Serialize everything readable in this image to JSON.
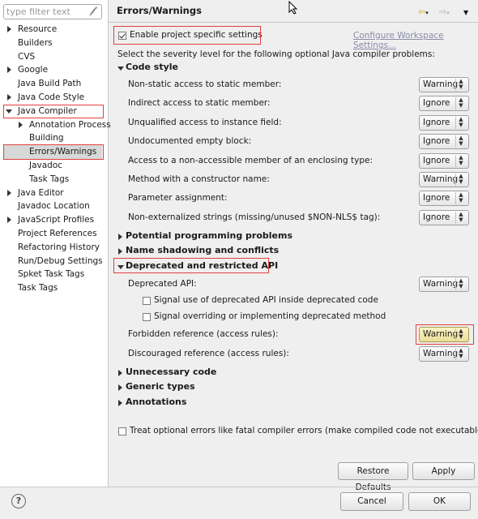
{
  "filter": {
    "placeholder": "type filter text"
  },
  "tree": [
    {
      "label": "Resource",
      "expandable": true
    },
    {
      "label": "Builders",
      "expandable": false
    },
    {
      "label": "CVS",
      "expandable": false
    },
    {
      "label": "Google",
      "expandable": true
    },
    {
      "label": "Java Build Path",
      "expandable": false
    },
    {
      "label": "Java Code Style",
      "expandable": true
    },
    {
      "label": "Java Compiler",
      "expandable": true,
      "expanded": true
    },
    {
      "label": "Annotation Process",
      "expandable": true,
      "child": true
    },
    {
      "label": "Building",
      "expandable": false,
      "child": true
    },
    {
      "label": "Errors/Warnings",
      "expandable": false,
      "child": true,
      "selected": true
    },
    {
      "label": "Javadoc",
      "expandable": false,
      "child": true
    },
    {
      "label": "Task Tags",
      "expandable": false,
      "child": true
    },
    {
      "label": "Java Editor",
      "expandable": true
    },
    {
      "label": "Javadoc Location",
      "expandable": false
    },
    {
      "label": "JavaScript Profiles",
      "expandable": true
    },
    {
      "label": "Project References",
      "expandable": false
    },
    {
      "label": "Refactoring History",
      "expandable": false
    },
    {
      "label": "Run/Debug Settings",
      "expandable": false
    },
    {
      "label": "Spket Task Tags",
      "expandable": false
    },
    {
      "label": "Task Tags",
      "expandable": false
    }
  ],
  "page": {
    "title": "Errors/Warnings",
    "enable_label": "Enable project specific settings",
    "configure_link": "Configure Workspace Settings...",
    "intro": "Select the severity level for the following optional Java compiler problems:"
  },
  "code_style": {
    "header": "Code style",
    "rows": [
      {
        "label": "Non-static access to static member:",
        "value": "Warning"
      },
      {
        "label": "Indirect access to static member:",
        "value": "Ignore"
      },
      {
        "label": "Unqualified access to instance field:",
        "value": "Ignore"
      },
      {
        "label": "Undocumented empty block:",
        "value": "Ignore"
      },
      {
        "label": "Access to a non-accessible member of an enclosing type:",
        "value": "Ignore"
      },
      {
        "label": "Method with a constructor name:",
        "value": "Warning"
      },
      {
        "label": "Parameter assignment:",
        "value": "Ignore"
      },
      {
        "label": "Non-externalized strings (missing/unused $NON-NLS$ tag):",
        "value": "Ignore"
      }
    ]
  },
  "sections": {
    "potential": "Potential programming problems",
    "shadowing": "Name shadowing and conflicts",
    "deprecated": "Deprecated and restricted API",
    "unnecessary": "Unnecessary code",
    "generic": "Generic types",
    "annotations": "Annotations"
  },
  "deprecated": {
    "api_label": "Deprecated API:",
    "api_value": "Warning",
    "opt1": "Signal use of deprecated API inside deprecated code",
    "opt2": "Signal overriding or implementing deprecated method",
    "forbidden_label": "Forbidden reference (access rules):",
    "forbidden_value": "Warning",
    "discouraged_label": "Discouraged reference (access rules):",
    "discouraged_value": "Warning"
  },
  "treat_label": "Treat optional errors like fatal compiler errors (make compiled code not executable)",
  "buttons": {
    "restore": "Restore Defaults",
    "apply": "Apply",
    "cancel": "Cancel",
    "ok": "OK",
    "help": "?"
  },
  "colors": {
    "highlight": "#e04040",
    "selected_bg": "#d8d8d8"
  }
}
